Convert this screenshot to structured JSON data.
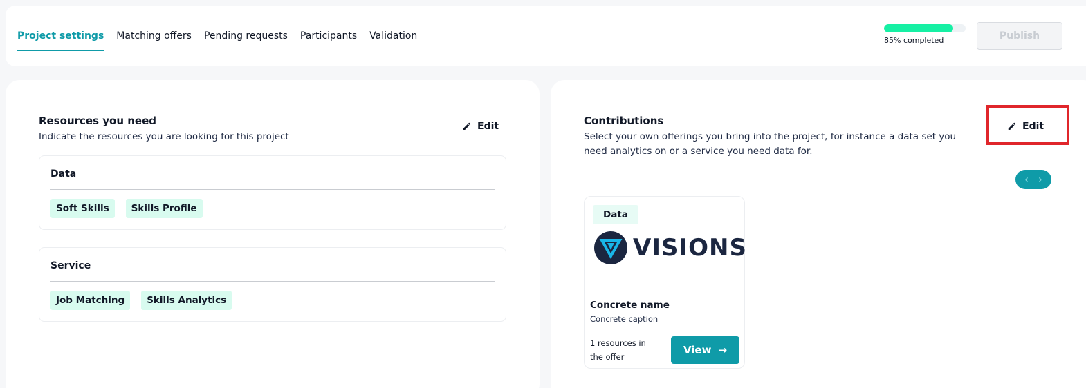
{
  "tabs": [
    {
      "label": "Project settings",
      "active": true
    },
    {
      "label": "Matching offers",
      "active": false
    },
    {
      "label": "Pending requests",
      "active": false
    },
    {
      "label": "Participants",
      "active": false
    },
    {
      "label": "Validation",
      "active": false
    }
  ],
  "progress": {
    "percent": 85,
    "label": "85% completed"
  },
  "publish_label": "Publish",
  "resources": {
    "title": "Resources you need",
    "subtitle": "Indicate the resources you are looking for this project",
    "edit_label": "Edit",
    "groups": [
      {
        "title": "Data",
        "items": [
          "Soft Skills",
          "Skills Profile"
        ]
      },
      {
        "title": "Service",
        "items": [
          "Job Matching",
          "Skills Analytics"
        ]
      }
    ]
  },
  "contributions": {
    "title": "Contributions",
    "subtitle": "Select your own offerings you bring into the project, for instance a data set you need analytics on or a service you need data for.",
    "edit_label": "Edit",
    "carousel": {
      "prev": "‹",
      "next": "›"
    },
    "offer": {
      "badge": "Data",
      "logo_text": "VISIONS",
      "name": "Concrete name",
      "caption": "Concrete caption",
      "count": "1 resources in the offer",
      "view_label": "View",
      "view_icon": "→"
    }
  },
  "colors": {
    "accent": "#0f9ba8",
    "progress": "#16f0a4",
    "chip": "#d8fbef",
    "highlight": "#e0262b"
  }
}
